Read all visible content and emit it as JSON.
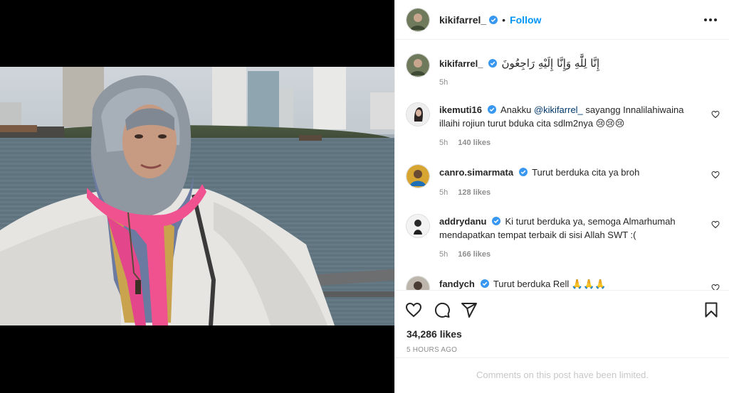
{
  "post": {
    "author": "kikifarrel_",
    "follow_label": "Follow",
    "dot": "•",
    "caption": "إِنَّا لِلَّٰهِ وَإِنَّا إِلَيْهِ رَاجِعُونَ",
    "caption_time": "5h",
    "likes": "34,286 likes",
    "posted_ago": "5 HOURS AGO",
    "comments_limited": "Comments on this post have been limited."
  },
  "comments": [
    {
      "user": "ikemuti16",
      "text_before": "Anakku ",
      "mention": "@kikifarrel_",
      "text_after": " sayangg Innalilahiwaina illaihi rojiun turut bduka cita sdlm2nya 😢😢😢",
      "time": "5h",
      "likes": "140 likes"
    },
    {
      "user": "canro.simarmata",
      "text": "Turut berduka cita ya broh",
      "time": "5h",
      "likes": "128 likes"
    },
    {
      "user": "addrydanu",
      "text": "Ki turut berduka ya, semoga Almarhumah mendapatkan tempat terbaik di sisi Allah SWT :(",
      "time": "5h",
      "likes": "166 likes"
    },
    {
      "user": "fandych",
      "text": "Turut berduka Rell 🙏🙏🙏"
    }
  ],
  "colors": {
    "link": "#0095f6",
    "verified": "#3897f0",
    "text": "#262626",
    "muted": "#8e8e8e",
    "scarf_pink": "#f0518f"
  },
  "icons": [
    "more-options-icon",
    "verified-icon",
    "heart-icon",
    "comment-icon",
    "share-icon",
    "bookmark-icon"
  ]
}
